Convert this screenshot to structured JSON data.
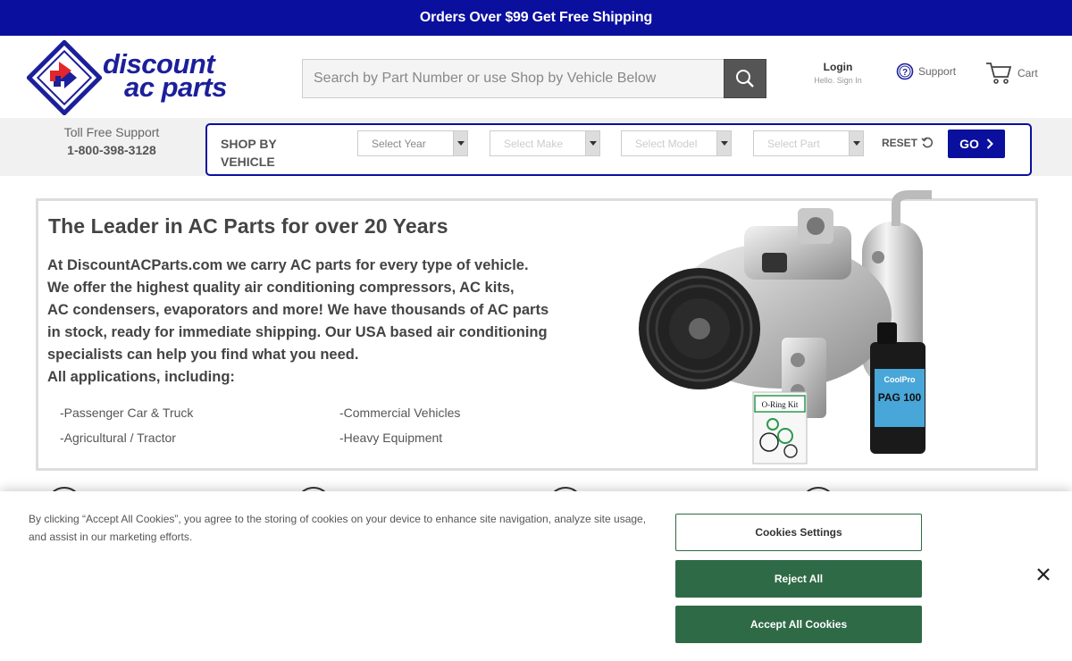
{
  "promo": {
    "text": "Orders Over $99 Get Free Shipping"
  },
  "logo": {
    "line1": "discount",
    "line2": "ac parts"
  },
  "search": {
    "placeholder": "Search by Part Number or use Shop by Vehicle Below"
  },
  "account": {
    "login": "Login",
    "sub": "Hello. Sign In"
  },
  "support": {
    "label": "Support"
  },
  "cart": {
    "label": "Cart"
  },
  "tollfree": {
    "label": "Toll Free Support",
    "phone": "1-800-398-3128"
  },
  "shop": {
    "title": "SHOP BY VEHICLE",
    "year": "Select Year",
    "make": "Select Make",
    "model": "Select Model",
    "part": "Select Part",
    "reset": "RESET",
    "go": "GO"
  },
  "hero": {
    "title": "The Leader in AC Parts for over 20 Years",
    "lines": [
      "At DiscountACParts.com we carry AC parts for every type of vehicle.",
      "We offer the highest quality air conditioning compressors, AC kits,",
      "AC condensers, evaporators and more! We have thousands of AC parts",
      "in stock, ready for immediate shipping. Our USA based air conditioning",
      "specialists can help you find what you need.",
      "All applications, including:"
    ],
    "applications": [
      "-Passenger Car & Truck",
      "-Commercial Vehicles",
      "-Agricultural / Tractor",
      "-Heavy Equipment"
    ],
    "product_labels": {
      "oring": "O-Ring Kit",
      "oil_brand": "CoolPro",
      "oil_type": "PAG 100"
    }
  },
  "cookie": {
    "text": "By clicking “Accept All Cookies”, you agree to the storing of cookies on your device to enhance site navigation, analyze site usage, and assist in our marketing efforts.",
    "settings": "Cookies Settings",
    "reject": "Reject All",
    "accept": "Accept All Cookies"
  },
  "colors": {
    "brand_blue": "#0a0f9e",
    "cookie_green": "#2f6a46",
    "logo_red": "#e3262c"
  }
}
